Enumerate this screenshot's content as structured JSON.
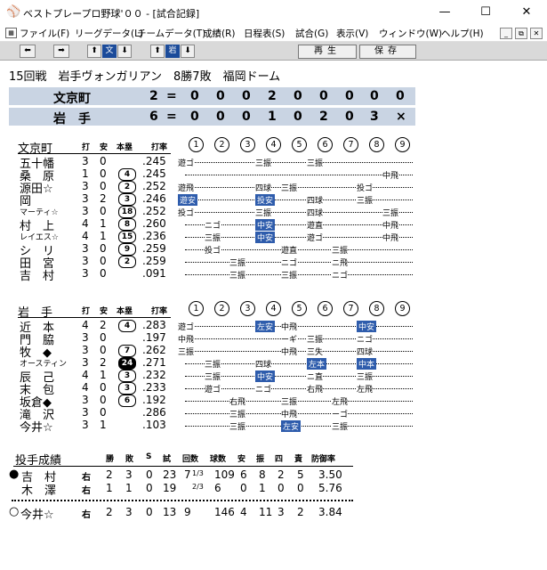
{
  "window": {
    "title": "ベストプレープロ野球'００ - [試合記録]",
    "app_icon": "baseball-app-icon",
    "min": "—",
    "max": "☐",
    "close": "✕"
  },
  "menu": {
    "items": [
      "ファイル(F)",
      "リーグデータ(L)",
      "チームデータ(T)",
      "成績(R)",
      "日程表(S)",
      "試合(G)",
      "表示(V)",
      "ウィンドウ(W)",
      "ヘルプ(H)"
    ],
    "mdi_min": "_",
    "mdi_restore": "⧉",
    "mdi_close": "✕"
  },
  "toolbar": {
    "prev": "⬅",
    "next": "➡",
    "away_up": "⬆",
    "away_label": "文",
    "away_down": "⬇",
    "home_up": "⬆",
    "home_label": "岩",
    "home_down": "⬇",
    "replay": "再生",
    "save": "保存"
  },
  "game": {
    "header": "15回戦　岩手ヴォンガリアン　8勝7敗　福岡ドーム"
  },
  "score": {
    "away": {
      "name": "文京町",
      "total": "2",
      "eq": "=",
      "innings": [
        "0",
        "0",
        "0",
        "2",
        "0",
        "0",
        "0",
        "0",
        "0"
      ]
    },
    "home": {
      "name": "岩　手",
      "total": "6",
      "eq": "=",
      "innings": [
        "0",
        "0",
        "0",
        "1",
        "0",
        "2",
        "0",
        "3",
        "×"
      ]
    }
  },
  "away_box": {
    "team": "文京町",
    "col_ab": "打",
    "col_h": "安",
    "col_rbi": "本塁",
    "col_avg": "打率",
    "innings": [
      "1",
      "2",
      "3",
      "4",
      "5",
      "6",
      "7",
      "8",
      "9"
    ],
    "players": [
      {
        "name": "五十幡",
        "ab": "3",
        "h": "0",
        "rbi": "",
        "avg": ".245"
      },
      {
        "name": "桑　原",
        "ab": "1",
        "h": "0",
        "rbi": "4",
        "avg": ".245"
      },
      {
        "name": "源田☆",
        "ab": "3",
        "h": "0",
        "rbi": "2",
        "avg": ".252"
      },
      {
        "name": "岡",
        "ab": "3",
        "h": "2",
        "rbi": "3",
        "avg": ".246"
      },
      {
        "name": "マーティ☆",
        "ab": "3",
        "h": "0",
        "rbi": "18",
        "avg": ".252"
      },
      {
        "name": "村　上",
        "ab": "4",
        "h": "1",
        "rbi": "8",
        "avg": ".260"
      },
      {
        "name": "レイエス☆",
        "ab": "4",
        "h": "1",
        "rbi": "15",
        "avg": ".236"
      },
      {
        "name": "シ　リ",
        "ab": "3",
        "h": "0",
        "rbi": "9",
        "avg": ".259"
      },
      {
        "name": "田　宮",
        "ab": "3",
        "h": "0",
        "rbi": "2",
        "avg": ".259"
      },
      {
        "name": "吉　村",
        "ab": "3",
        "h": "0",
        "rbi": "",
        "avg": ".091"
      }
    ],
    "results": [
      [
        "遊ゴ",
        "三振",
        "三振"
      ],
      [
        "中飛"
      ],
      [
        "遊飛",
        "四球",
        "三振",
        "投ゴ"
      ],
      [
        "遊安",
        "投安",
        "四球",
        "三振"
      ],
      [
        "投ゴ",
        "三振",
        "四球",
        "三振"
      ],
      [
        "ニゴ",
        "中安",
        "遊直",
        "中飛"
      ],
      [
        "三振",
        "中安",
        "遊ゴ",
        "中飛"
      ],
      [
        "投ゴ",
        "遊直",
        "三振"
      ],
      [
        "三振",
        "ニゴ",
        "ニ飛"
      ],
      [
        "三振",
        "三振",
        "ニゴ"
      ]
    ]
  },
  "home_box": {
    "team": "岩　手",
    "col_ab": "打",
    "col_h": "安",
    "col_rbi": "本塁",
    "col_avg": "打率",
    "innings": [
      "1",
      "2",
      "3",
      "4",
      "5",
      "6",
      "7",
      "8",
      "9"
    ],
    "players": [
      {
        "name": "近　本",
        "ab": "4",
        "h": "2",
        "rbi": "4",
        "avg": ".283"
      },
      {
        "name": "門　脇",
        "ab": "3",
        "h": "0",
        "rbi": "",
        "avg": ".197"
      },
      {
        "name": "牧　◆",
        "ab": "3",
        "h": "0",
        "rbi": "7",
        "avg": ".262"
      },
      {
        "name": "オースティン",
        "ab": "3",
        "h": "2",
        "rbi": "24",
        "avg": ".271"
      },
      {
        "name": "辰　己",
        "ab": "4",
        "h": "1",
        "rbi": "3",
        "avg": ".232"
      },
      {
        "name": "末　包",
        "ab": "4",
        "h": "0",
        "rbi": "3",
        "avg": ".233"
      },
      {
        "name": "坂倉◆",
        "ab": "3",
        "h": "0",
        "rbi": "6",
        "avg": ".192"
      },
      {
        "name": "滝　沢",
        "ab": "3",
        "h": "0",
        "rbi": "",
        "avg": ".286"
      },
      {
        "name": "今井☆",
        "ab": "3",
        "h": "1",
        "rbi": "",
        "avg": ".103"
      }
    ],
    "results": [
      [
        "遊ゴ",
        "左安",
        "中飛",
        "中安"
      ],
      [
        "中飛",
        "ーギ",
        "三振",
        "ニゴ"
      ],
      [
        "三振",
        "中飛",
        "三失",
        "四球"
      ],
      [
        "三振",
        "四球",
        "左本",
        "中本"
      ],
      [
        "三振",
        "中安",
        "ニ直",
        "三振"
      ],
      [
        "遊ゴ",
        "ニゴ",
        "右飛",
        "左飛"
      ],
      [
        "右飛",
        "三振",
        "左飛"
      ],
      [
        "三振",
        "中飛",
        "ーゴ"
      ],
      [
        "三振",
        "左安",
        "三振"
      ]
    ]
  },
  "pitching": {
    "title": "投手成績",
    "headers": [
      "勝",
      "敗",
      "S",
      "試",
      "回数",
      "球数",
      "安",
      "振",
      "四",
      "責",
      "防御率"
    ],
    "rows": [
      {
        "mark": "●",
        "name": "吉　村",
        "hand": "右",
        "w": "2",
        "l": "3",
        "s": "0",
        "g": "23",
        "ip_whole": "7",
        "ip_frac": "1/3",
        "pitches": "109",
        "h": "6",
        "k": "8",
        "bb": "2",
        "er": "5",
        "era": "3.50"
      },
      {
        "mark": "",
        "name": "木　澤",
        "hand": "右",
        "w": "1",
        "l": "1",
        "s": "0",
        "g": "19",
        "ip_whole": "",
        "ip_frac": "2/3",
        "pitches": "6",
        "h": "0",
        "k": "1",
        "bb": "0",
        "er": "0",
        "era": "5.76"
      },
      {
        "mark": "○",
        "name": "今井☆",
        "hand": "右",
        "w": "2",
        "l": "3",
        "s": "0",
        "g": "13",
        "ip_whole": "9",
        "ip_frac": "",
        "pitches": "146",
        "h": "4",
        "k": "11",
        "bb": "3",
        "er": "2",
        "era": "3.84"
      }
    ]
  },
  "colors": {
    "toolbar": "#d9d9d9",
    "scorebar": "#c9d4e3",
    "highlight": "#2e5cac"
  }
}
